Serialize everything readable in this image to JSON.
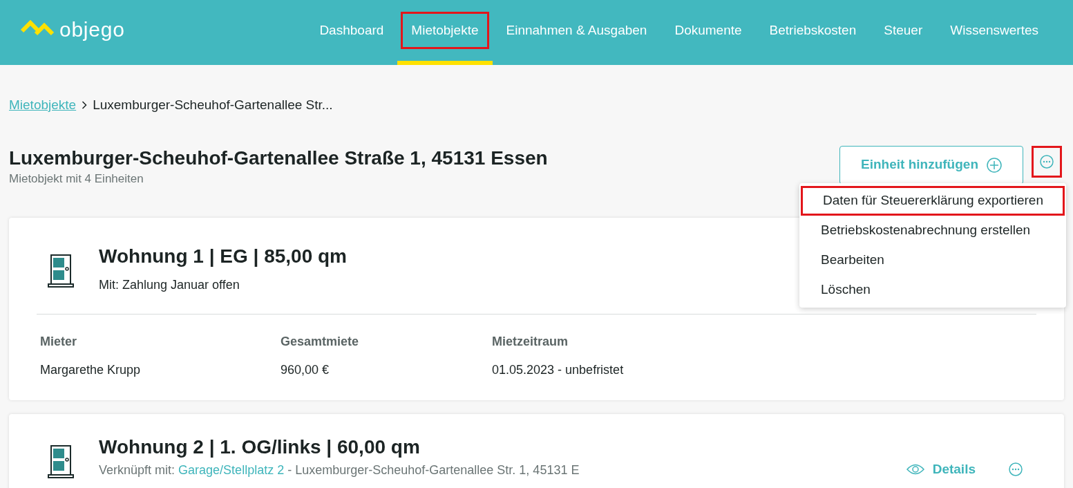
{
  "header": {
    "logo": "objego",
    "nav": [
      {
        "label": "Dashboard",
        "selected": false,
        "highlighted": false
      },
      {
        "label": "Mietobjekte",
        "selected": true,
        "highlighted": true
      },
      {
        "label": "Einnahmen & Ausgaben",
        "selected": false,
        "highlighted": false
      },
      {
        "label": "Dokumente",
        "selected": false,
        "highlighted": false
      },
      {
        "label": "Betriebskosten",
        "selected": false,
        "highlighted": false
      },
      {
        "label": "Steuer",
        "selected": false,
        "highlighted": false
      },
      {
        "label": "Wissenswertes",
        "selected": false,
        "highlighted": false
      }
    ]
  },
  "breadcrumb": {
    "link": "Mietobjekte",
    "current": "Luxemburger-Scheuhof-Gartenallee Str..."
  },
  "page": {
    "title": "Luxemburger-Scheuhof-Gartenallee Straße 1, 45131 Essen",
    "subtitle": "Mietobjekt mit 4 Einheiten",
    "add_button": "Einheit hinzufügen",
    "more_highlighted": true
  },
  "menu": [
    {
      "label": "Daten für Steuererklärung exportieren",
      "highlighted": true
    },
    {
      "label": "Betriebskostenabrechnung erstellen",
      "highlighted": false
    },
    {
      "label": "Bearbeiten",
      "highlighted": false
    },
    {
      "label": "Löschen",
      "highlighted": false
    }
  ],
  "units": [
    {
      "title": "Wohnung 1 | EG | 85,00 qm",
      "kind": "status",
      "subtitle": "Mit: Zahlung Januar offen",
      "columns": [
        {
          "label": "Mieter",
          "value": "Margarethe Krupp"
        },
        {
          "label": "Gesamtmiete",
          "value": "960,00 €"
        },
        {
          "label": "Mietzeitraum",
          "value": "01.05.2023 - unbefristet"
        }
      ]
    },
    {
      "title": "Wohnung 2 | 1. OG/links | 60,00 qm",
      "kind": "linked",
      "link_prefix": "Verknüpft mit:",
      "link": "Garage/Stellplatz 2",
      "link_suffix": "- Luxemburger-Scheuhof-Gartenallee Str. 1, 45131 E",
      "details": "Details"
    }
  ]
}
